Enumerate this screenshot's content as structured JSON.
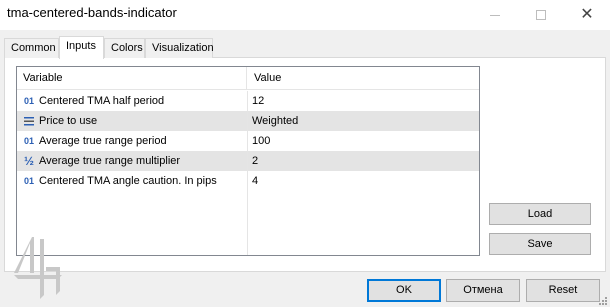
{
  "window": {
    "title": "tma-centered-bands-indicator",
    "close_glyph": "✕"
  },
  "tabs": [
    {
      "label": "Common",
      "active": false
    },
    {
      "label": "Inputs",
      "active": true
    },
    {
      "label": "Colors",
      "active": false
    },
    {
      "label": "Visualization",
      "active": false
    }
  ],
  "table": {
    "headers": {
      "variable": "Variable",
      "value": "Value"
    },
    "rows": [
      {
        "icon": "01",
        "icon_name": "integer-icon",
        "name": "Centered TMA half period",
        "value": "12"
      },
      {
        "icon": "",
        "icon_name": "enum-icon",
        "name": "Price to use",
        "value": "Weighted"
      },
      {
        "icon": "01",
        "icon_name": "integer-icon",
        "name": "Average true range period",
        "value": "100"
      },
      {
        "icon": "½",
        "icon_name": "double-icon",
        "name": "Average true range multiplier",
        "value": "2"
      },
      {
        "icon": "01",
        "icon_name": "integer-icon",
        "name": "Centered TMA angle caution. In pips",
        "value": "4"
      }
    ]
  },
  "side_buttons": {
    "load": "Load",
    "save": "Save"
  },
  "footer": {
    "ok": "OK",
    "cancel": "Отмена",
    "reset": "Reset"
  },
  "colors": {
    "accent": "#0078d7",
    "row_alt": "#e4e4e4",
    "icon_blue": "#2b5fb4"
  }
}
